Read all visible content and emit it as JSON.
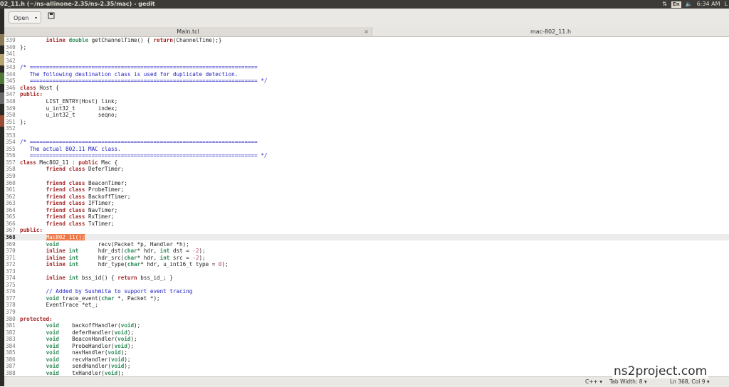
{
  "topbar": {
    "title": "02_11.h (~/ns-allinone-2.35/ns-2.35/mac) - gedit",
    "lang": "En",
    "volume_icon": "volume-icon",
    "time": "6:34 AM",
    "user": "L"
  },
  "header": {
    "open_label": "Open",
    "open_arrow": "▾",
    "save_icon": "save-icon"
  },
  "tabs": [
    {
      "label": "Main.tcl",
      "close": "×"
    },
    {
      "label": "mac-802_11.h"
    }
  ],
  "code": [
    {
      "n": "339",
      "html": "        <span class=\"kw\">inline</span> <span class=\"ty\">double</span> getChannelTime() { <span class=\"kw\">return</span>(ChannelTime);}"
    },
    {
      "n": "340",
      "html": "};"
    },
    {
      "n": "341",
      "html": ""
    },
    {
      "n": "342",
      "html": ""
    },
    {
      "n": "343",
      "html": "<span class=\"cm\">/* ======================================================================</span>"
    },
    {
      "n": "344",
      "html": "<span class=\"cm\">   The following destination class is used for duplicate detection.</span>"
    },
    {
      "n": "345",
      "html": "<span class=\"cm\">   ====================================================================== */</span>"
    },
    {
      "n": "346",
      "html": "<span class=\"kw\">class</span> Host {"
    },
    {
      "n": "347",
      "html": "<span class=\"kw\">public:</span>"
    },
    {
      "n": "348",
      "html": "        LIST_ENTRY(Host) link;"
    },
    {
      "n": "349",
      "html": "        u_int32_t       index;"
    },
    {
      "n": "350",
      "html": "        u_int32_t       seqno;"
    },
    {
      "n": "351",
      "html": "};"
    },
    {
      "n": "352",
      "html": ""
    },
    {
      "n": "353",
      "html": ""
    },
    {
      "n": "354",
      "html": "<span class=\"cm\">/* ======================================================================</span>"
    },
    {
      "n": "355",
      "html": "<span class=\"cm\">   The actual 802.11 MAC class.</span>"
    },
    {
      "n": "356",
      "html": "<span class=\"cm\">   ====================================================================== */</span>"
    },
    {
      "n": "357",
      "html": "<span class=\"kw\">class</span> Mac802_11 : <span class=\"kw\">public</span> Mac {"
    },
    {
      "n": "358",
      "html": "        <span class=\"kw\">friend class</span> DeferTimer;"
    },
    {
      "n": "359",
      "html": ""
    },
    {
      "n": "360",
      "html": "        <span class=\"kw\">friend class</span> BeaconTimer;"
    },
    {
      "n": "361",
      "html": "        <span class=\"kw\">friend class</span> ProbeTimer;"
    },
    {
      "n": "362",
      "html": "        <span class=\"kw\">friend class</span> BackoffTimer;"
    },
    {
      "n": "363",
      "html": "        <span class=\"kw\">friend class</span> IFTimer;"
    },
    {
      "n": "364",
      "html": "        <span class=\"kw\">friend class</span> NavTimer;"
    },
    {
      "n": "365",
      "html": "        <span class=\"kw\">friend class</span> RxTimer;"
    },
    {
      "n": "366",
      "html": "        <span class=\"kw\">friend class</span> TxTimer;"
    },
    {
      "n": "367",
      "html": "<span class=\"kw\">public:</span>"
    },
    {
      "n": "368",
      "html": "        <span class=\"hl\">Mac802_11();</span>",
      "current": true
    },
    {
      "n": "369",
      "html": "        <span class=\"ty\">void</span>            recv(Packet *p, Handler *h);"
    },
    {
      "n": "370",
      "html": "        <span class=\"kw\">inline</span> <span class=\"ty\">int</span>      hdr_dst(<span class=\"ty\">char</span>* hdr, <span class=\"ty\">int</span> dst = <span class=\"nu\">-2</span>);"
    },
    {
      "n": "371",
      "html": "        <span class=\"kw\">inline</span> <span class=\"ty\">int</span>      hdr_src(<span class=\"ty\">char</span>* hdr, <span class=\"ty\">int</span> src = <span class=\"nu\">-2</span>);"
    },
    {
      "n": "372",
      "html": "        <span class=\"kw\">inline</span> <span class=\"ty\">int</span>      hdr_type(<span class=\"ty\">char</span>* hdr, u_int16_t type = <span class=\"nu\">0</span>);"
    },
    {
      "n": "373",
      "html": ""
    },
    {
      "n": "374",
      "html": "        <span class=\"kw\">inline</span> <span class=\"ty\">int</span> bss_id() { <span class=\"kw\">return</span> bss_id_; }"
    },
    {
      "n": "375",
      "html": ""
    },
    {
      "n": "376",
      "html": "        <span class=\"cm\">// Added by Sushmita to support event tracing</span>"
    },
    {
      "n": "377",
      "html": "        <span class=\"ty\">void</span> trace_event(<span class=\"ty\">char</span> *, Packet *);"
    },
    {
      "n": "378",
      "html": "        EventTrace *et_;"
    },
    {
      "n": "379",
      "html": ""
    },
    {
      "n": "380",
      "html": "<span class=\"kw\">protected:</span>"
    },
    {
      "n": "381",
      "html": "        <span class=\"ty\">void</span>    backoffHandler(<span class=\"ty\">void</span>);"
    },
    {
      "n": "382",
      "html": "        <span class=\"ty\">void</span>    deferHandler(<span class=\"ty\">void</span>);"
    },
    {
      "n": "383",
      "html": "        <span class=\"ty\">void</span>    BeaconHandler(<span class=\"ty\">void</span>);"
    },
    {
      "n": "384",
      "html": "        <span class=\"ty\">void</span>    ProbeHandler(<span class=\"ty\">void</span>);"
    },
    {
      "n": "385",
      "html": "        <span class=\"ty\">void</span>    navHandler(<span class=\"ty\">void</span>);"
    },
    {
      "n": "386",
      "html": "        <span class=\"ty\">void</span>    recvHandler(<span class=\"ty\">void</span>);"
    },
    {
      "n": "387",
      "html": "        <span class=\"ty\">void</span>    sendHandler(<span class=\"ty\">void</span>);"
    },
    {
      "n": "388",
      "html": "        <span class=\"ty\">void</span>    txHandler(<span class=\"ty\">void</span>);"
    }
  ],
  "status": {
    "language": "C++ ▾",
    "tab_width": "Tab Width: 8 ▾",
    "position": "Ln 368, Col 9 ▾"
  },
  "watermark": "ns2project.com"
}
